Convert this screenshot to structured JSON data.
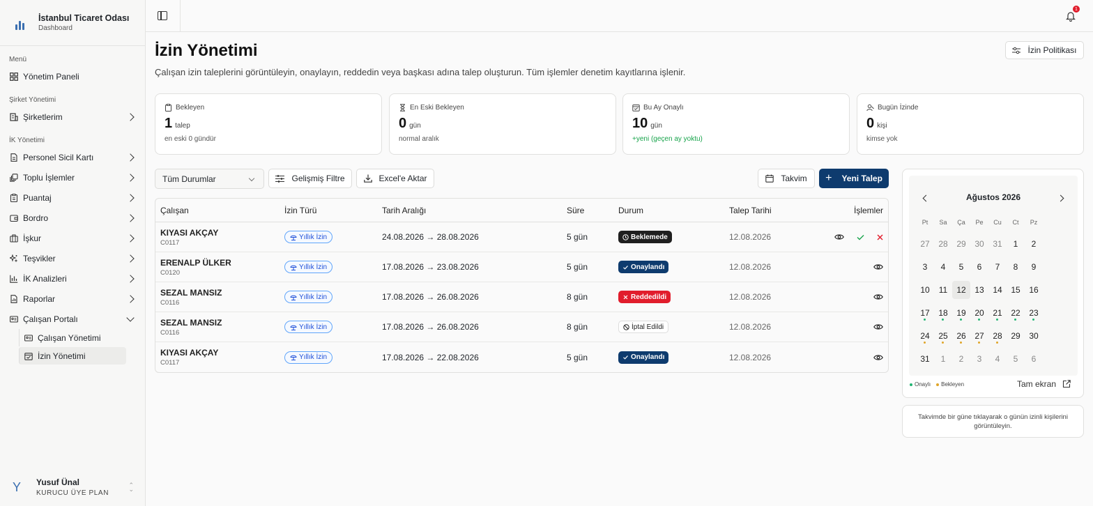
{
  "brand": {
    "title": "İstanbul Ticaret Odası",
    "subtitle": "Dashboard"
  },
  "sidebar": {
    "sections": [
      {
        "label": "Menü",
        "items": [
          {
            "label": "Yönetim Paneli",
            "icon": "dashboard-icon"
          }
        ]
      },
      {
        "label": "Şirket Yönetimi",
        "items": [
          {
            "label": "Şirketlerim",
            "icon": "building-icon"
          }
        ]
      },
      {
        "label": "İK Yönetimi",
        "items": [
          {
            "label": "Personel Sicil Kartı",
            "icon": "file-icon"
          },
          {
            "label": "Toplu İşlemler",
            "icon": "layers-icon"
          },
          {
            "label": "Puantaj",
            "icon": "clipboard-icon"
          },
          {
            "label": "Bordro",
            "icon": "wallet-icon"
          },
          {
            "label": "İşkur",
            "icon": "briefcase-icon"
          },
          {
            "label": "Teşvikler",
            "icon": "sparkles-icon"
          },
          {
            "label": "İK Analizleri",
            "icon": "chart-icon"
          },
          {
            "label": "Raporlar",
            "icon": "report-icon"
          },
          {
            "label": "Çalışan Portalı",
            "icon": "id-card-icon"
          }
        ]
      }
    ],
    "subitems": [
      {
        "label": "Çalışan Yönetimi",
        "icon": "id-card-icon"
      },
      {
        "label": "İzin Yönetimi",
        "icon": "calendar-check-icon"
      }
    ],
    "user": {
      "avatar": "Y",
      "name": "Yusuf Ünal",
      "plan": "KURUCU ÜYE PLAN"
    }
  },
  "topbar": {
    "notification_count": "1"
  },
  "page": {
    "title": "İzin Yönetimi",
    "description": "Çalışan izin taleplerini görüntüleyin, onaylayın, reddedin veya başkası adına talep oluşturun. Tüm işlemler denetim kayıtlarına işlenir.",
    "policy_button": "İzin Politikası"
  },
  "stats": [
    {
      "label": "Bekleyen",
      "value": "1",
      "unit": "talep",
      "note": "en eski 0 gündür",
      "note_color": "#555555"
    },
    {
      "label": "En Eski Bekleyen",
      "value": "0",
      "unit": "gün",
      "note": "normal aralık",
      "note_color": "#555555"
    },
    {
      "label": "Bu Ay Onaylı",
      "value": "10",
      "unit": "gün",
      "note": "+yeni (geçen ay yoktu)",
      "note_color": "#16a34a"
    },
    {
      "label": "Bugün İzinde",
      "value": "0",
      "unit": "kişi",
      "note": "kimse yok",
      "note_color": "#555555"
    }
  ],
  "toolbar": {
    "status_filter": "Tüm Durumlar",
    "advanced_filter": "Gelişmiş Filtre",
    "export": "Excel'e Aktar",
    "calendar": "Takvim",
    "new_request": "Yeni Talep"
  },
  "table": {
    "headers": {
      "employee": "Çalışan",
      "type": "İzin Türü",
      "range": "Tarih Aralığı",
      "duration": "Süre",
      "status": "Durum",
      "request_date": "Talep Tarihi",
      "actions": "İşlemler"
    },
    "rows": [
      {
        "name": "KIYASI AKÇAY",
        "id": "C0117",
        "type": "Yıllık İzin",
        "range": "24.08.2026 → 28.08.2026",
        "duration": "5 gün",
        "status": "Beklemede",
        "status_kind": "pending",
        "date": "12.08.2026"
      },
      {
        "name": "ERENALP ÜLKER",
        "id": "C0120",
        "type": "Yıllık İzin",
        "range": "17.08.2026 → 23.08.2026",
        "duration": "5 gün",
        "status": "Onaylandı",
        "status_kind": "approved",
        "date": "12.08.2026"
      },
      {
        "name": "SEZAL MANSIZ",
        "id": "C0116",
        "type": "Yıllık İzin",
        "range": "17.08.2026 → 26.08.2026",
        "duration": "8 gün",
        "status": "Reddedildi",
        "status_kind": "rejected",
        "date": "12.08.2026"
      },
      {
        "name": "SEZAL MANSIZ",
        "id": "C0116",
        "type": "Yıllık İzin",
        "range": "17.08.2026 → 26.08.2026",
        "duration": "8 gün",
        "status": "İptal Edildi",
        "status_kind": "cancelled",
        "date": "12.08.2026"
      },
      {
        "name": "KIYASI AKÇAY",
        "id": "C0117",
        "type": "Yıllık İzin",
        "range": "17.08.2026 → 22.08.2026",
        "duration": "5 gün",
        "status": "Onaylandı",
        "status_kind": "approved",
        "date": "12.08.2026"
      }
    ]
  },
  "calendar": {
    "month": "Ağustos 2026",
    "weekdays": [
      "Pt",
      "Sa",
      "Ça",
      "Pe",
      "Cu",
      "Ct",
      "Pz"
    ],
    "weeks": [
      [
        {
          "d": "27",
          "m": true
        },
        {
          "d": "28",
          "m": true
        },
        {
          "d": "29",
          "m": true
        },
        {
          "d": "30",
          "m": true
        },
        {
          "d": "31",
          "m": true
        },
        {
          "d": "1"
        },
        {
          "d": "2"
        }
      ],
      [
        {
          "d": "3"
        },
        {
          "d": "4"
        },
        {
          "d": "5"
        },
        {
          "d": "6"
        },
        {
          "d": "7"
        },
        {
          "d": "8"
        },
        {
          "d": "9"
        }
      ],
      [
        {
          "d": "10"
        },
        {
          "d": "11"
        },
        {
          "d": "12",
          "today": true
        },
        {
          "d": "13"
        },
        {
          "d": "14"
        },
        {
          "d": "15"
        },
        {
          "d": "16"
        }
      ],
      [
        {
          "d": "17",
          "dot": "approved"
        },
        {
          "d": "18",
          "dot": "approved"
        },
        {
          "d": "19",
          "dot": "approved"
        },
        {
          "d": "20",
          "dot": "approved"
        },
        {
          "d": "21",
          "dot": "approved"
        },
        {
          "d": "22",
          "dot": "approved"
        },
        {
          "d": "23",
          "dot": "approved"
        }
      ],
      [
        {
          "d": "24",
          "dot": "pending"
        },
        {
          "d": "25",
          "dot": "pending"
        },
        {
          "d": "26",
          "dot": "pending"
        },
        {
          "d": "27",
          "dot": "pending"
        },
        {
          "d": "28",
          "dot": "pending"
        },
        {
          "d": "29"
        },
        {
          "d": "30"
        }
      ],
      [
        {
          "d": "31"
        },
        {
          "d": "1",
          "m": true
        },
        {
          "d": "2",
          "m": true
        },
        {
          "d": "3",
          "m": true
        },
        {
          "d": "4",
          "m": true
        },
        {
          "d": "5",
          "m": true
        },
        {
          "d": "6",
          "m": true
        }
      ]
    ],
    "legend_approved": "Onaylı",
    "legend_pending": "Bekleyen",
    "fullscreen": "Tam ekran",
    "hint": "Takvimde bir güne tıklayarak o günün izinli kişilerini görüntüleyin."
  },
  "colors": {
    "approved_dot": "#22b573",
    "pending_dot": "#e0a528",
    "primary": "#0e3b6e"
  }
}
